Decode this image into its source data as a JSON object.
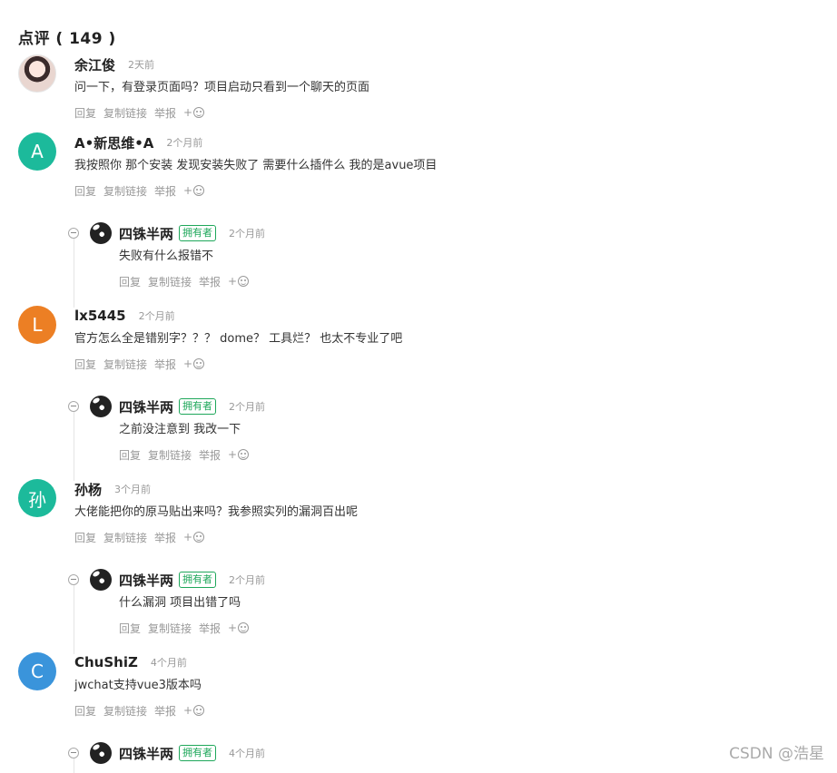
{
  "header": {
    "title": "点评 ( 149 )"
  },
  "actions": {
    "reply": "回复",
    "copy_link": "复制链接",
    "report": "举报",
    "emoji_plus": "+"
  },
  "badge_owner": "拥有者",
  "comments": [
    {
      "avatar_letter": "",
      "avatar_color": "#f0d8d0",
      "name": "余江俊",
      "time": "2天前",
      "text": "问一下，有登录页面吗？项目启动只看到一个聊天的页面"
    },
    {
      "avatar_letter": "A",
      "avatar_color": "#1cba9b",
      "name": "A•新思维•A",
      "time": "2个月前",
      "text": "我按照你 那个安装 发现安装失败了 需要什么插件么 我的是avue项目",
      "reply": {
        "name": "四铢半两",
        "time": "2个月前",
        "text": "失败有什么报错不"
      }
    },
    {
      "avatar_letter": "L",
      "avatar_color": "#ec7f24",
      "name": "lx5445",
      "time": "2个月前",
      "text": "官方怎么全是错别字？？？ dome？ 工具烂？ 也太不专业了吧",
      "reply": {
        "name": "四铢半两",
        "time": "2个月前",
        "text": "之前没注意到 我改一下"
      }
    },
    {
      "avatar_letter": "孙",
      "avatar_color": "#1cba9b",
      "name": "孙杨",
      "time": "3个月前",
      "text": "大佬能把你的原马贴出来吗？我参照实列的漏洞百出呢",
      "reply": {
        "name": "四铢半两",
        "time": "2个月前",
        "text": "什么漏洞 项目出错了吗"
      }
    },
    {
      "avatar_letter": "C",
      "avatar_color": "#3a94db",
      "name": "ChuShiZ",
      "time": "4个月前",
      "text": "jwchat支持vue3版本吗",
      "reply": {
        "name": "四铢半两",
        "time": "4个月前",
        "text": ""
      }
    }
  ],
  "watermark": "CSDN @浩星"
}
